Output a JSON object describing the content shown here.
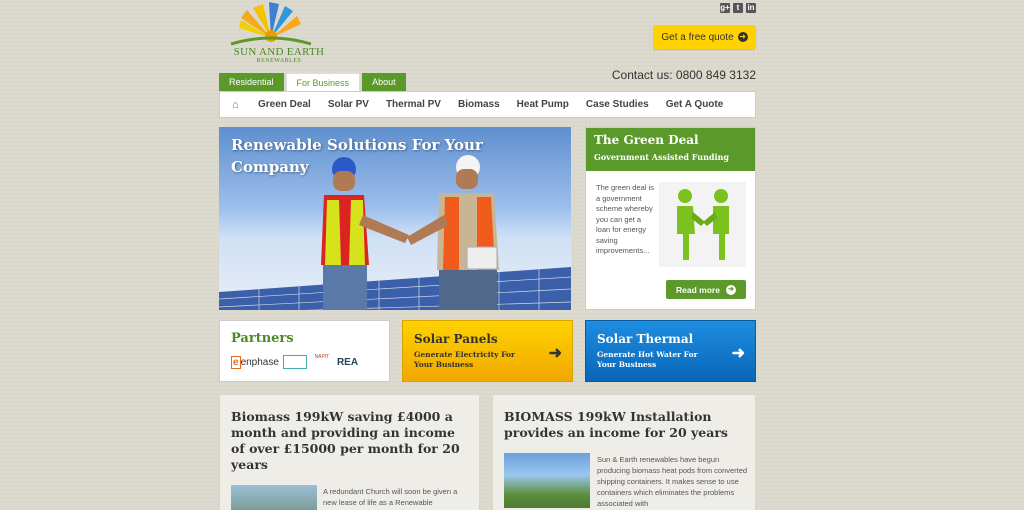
{
  "header": {
    "logo_text": "SUN AND EARTH",
    "logo_sub": "RENEWABLES",
    "social": [
      {
        "icon": "google-plus-icon",
        "glyph": "g+"
      },
      {
        "icon": "twitter-icon",
        "glyph": "t"
      },
      {
        "icon": "linkedin-icon",
        "glyph": "in"
      }
    ],
    "quote_button": "Get a free quote",
    "contact": "Contact us: 0800 849 3132"
  },
  "tabs": [
    "Residential",
    "For Business",
    "About"
  ],
  "active_tab": "For Business",
  "nav": {
    "home_icon": "home-icon",
    "items": [
      "Green Deal",
      "Solar PV",
      "Thermal PV",
      "Biomass",
      "Heat Pump",
      "Case Studies",
      "Get A Quote"
    ]
  },
  "hero": {
    "title": "Renewable Solutions For Your Company"
  },
  "green_deal": {
    "title": "The Green Deal",
    "subtitle": "Government Assisted Funding",
    "text": "The green deal is a government scheme whereby you can get a loan for energy saving improvements...",
    "read_more": "Read more"
  },
  "partners": {
    "title": "Partners",
    "logos": {
      "enphase_mark": "e",
      "enphase": "enphase",
      "napit": "NAPIT",
      "rea": "REA"
    }
  },
  "solar_panels": {
    "title": "Solar Panels",
    "subtitle": "Generate Electricity For Your Business"
  },
  "solar_thermal": {
    "title": "Solar Thermal",
    "subtitle": "Generate Hot Water For Your Business"
  },
  "news": [
    {
      "title": "Biomass 199kW saving £4000 a month and providing an income of over £15000 per month for 20 years",
      "excerpt": "A redundant Church will soon be given a new lease of life as a Renewable"
    },
    {
      "title": "BIOMASS 199kW Installation provides an income for 20 years",
      "excerpt": "Sun & Earth renewables have begun producing biomass heat pods from converted shipping containers. It makes sense to use containers which eliminates the problems associated with"
    }
  ],
  "colors": {
    "brand_green": "#5b9a2a",
    "quote_yellow": "#ffd200",
    "thermal_blue": "#0866b8"
  }
}
